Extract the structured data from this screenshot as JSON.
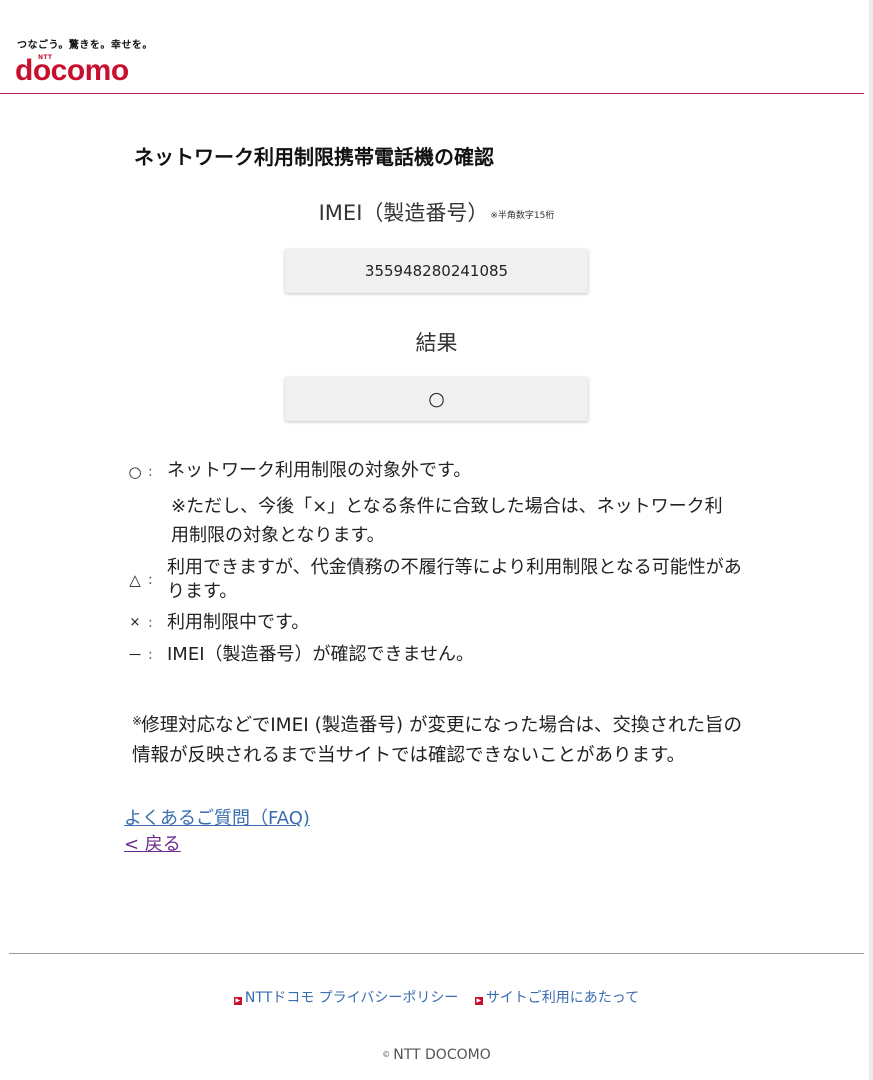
{
  "header": {
    "tagline": "つなごう。驚きを。幸せを。",
    "logo_sub": "NTT",
    "logo_text": "docomo",
    "brand_color": "#c8102e"
  },
  "main": {
    "title": "ネットワーク利用制限携帯電話機の確認",
    "imei_label": "IMEI（製造番号）",
    "imei_note": "※半角数字15桁",
    "imei_value": "355948280241085",
    "result_label": "結果",
    "result_value": "○"
  },
  "legend": [
    {
      "symbol": "○",
      "colon": ":",
      "text": "ネットワーク利用制限の対象外です。"
    },
    {
      "symbol": "△",
      "colon": ":",
      "text": "利用できますが、代金債務の不履行等により利用制限となる可能性があります。"
    },
    {
      "symbol": "×",
      "colon": ":",
      "text": "利用制限中です。"
    },
    {
      "symbol": "－",
      "colon": ":",
      "text": "IMEI（製造番号）が確認できません。"
    }
  ],
  "legend_circle_note": "※ただし、今後「×」となる条件に合致した場合は、ネットワーク利用制限の対象となります。",
  "imei_change_note": {
    "mark": "※",
    "text": "修理対応などでIMEI (製造番号) が変更になった場合は、交換された旨の情報が反映されるまで当サイトでは確認できないことがあります。"
  },
  "links": {
    "faq": "よくあるご質問（FAQ)",
    "back": "< 戻る"
  },
  "footer": {
    "privacy": "NTTドコモ プライバシーポリシー",
    "terms": "サイトご利用にあたって",
    "copyright_mark": "©",
    "copyright": "NTT DOCOMO",
    "link_icon": "arrow-right-icon"
  }
}
